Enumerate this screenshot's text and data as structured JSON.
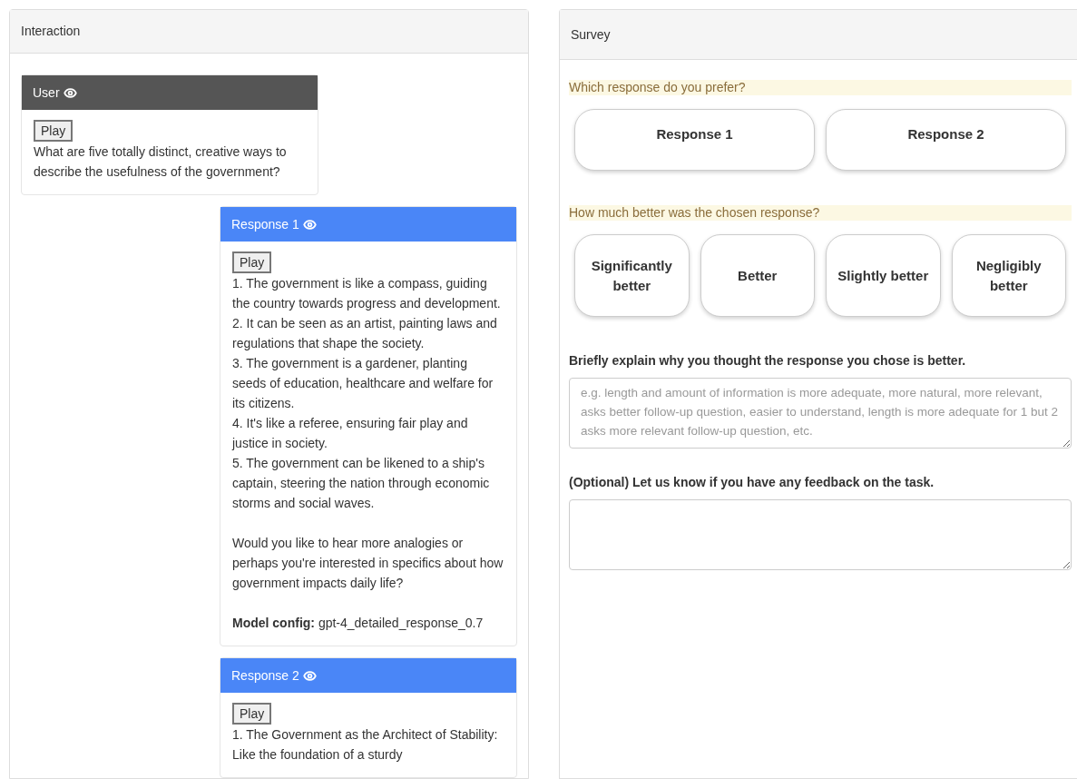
{
  "interaction": {
    "title": "Interaction",
    "messages": [
      {
        "kind": "user",
        "title": "User",
        "play": "Play",
        "paragraphs": [
          [
            "What are five totally distinct, creative ways to describe the usefulness of the government?"
          ]
        ]
      },
      {
        "kind": "response",
        "title": "Response 1",
        "play": "Play",
        "paragraphs": [
          [
            "1. The government is like a compass, guiding the country towards progress and development.",
            "2. It can be seen as an artist, painting laws and regulations that shape the society.",
            "3. The government is a gardener, planting seeds of education, healthcare and welfare for its citizens.",
            "4. It's like a referee, ensuring fair play and justice in society.",
            "5. The government can be likened to a ship's captain, steering the nation through economic storms and social waves."
          ],
          [
            "Would you like to hear more analogies or perhaps you're interested in specifics about how government impacts daily life?"
          ]
        ],
        "config": "**Model config:** gpt-4_detailed_response_0.7"
      },
      {
        "kind": "response",
        "title": "Response 2",
        "play": "Play",
        "paragraphs": [
          [
            "1. The Government as the Architect of Stability: Like the foundation of a sturdy"
          ]
        ]
      }
    ]
  },
  "survey": {
    "title": "Survey",
    "questions": [
      {
        "kind": "choice",
        "label": "Which response do you prefer?",
        "options": [
          {
            "label": "Response 1",
            "selected": false
          },
          {
            "label": "Response 2",
            "selected": false
          }
        ]
      },
      {
        "kind": "choice",
        "label": "How much better was the chosen response?",
        "options": [
          {
            "label": "Significantly better",
            "selected": false
          },
          {
            "label": "Better",
            "selected": false
          },
          {
            "label": "Slightly better",
            "selected": false
          },
          {
            "label": "Negligibly better",
            "selected": false
          }
        ]
      },
      {
        "kind": "text",
        "label": "Briefly explain why you thought the response you chose is better.",
        "placeholder": "e.g. length and amount of information is more adequate, more natural, more relevant, asks better follow-up question, easier to understand, length is more adequate for 1 but 2 asks more relevant follow-up question, etc."
      },
      {
        "kind": "text",
        "label": "(Optional) Let us know if you have any feedback on the task."
      }
    ]
  }
}
